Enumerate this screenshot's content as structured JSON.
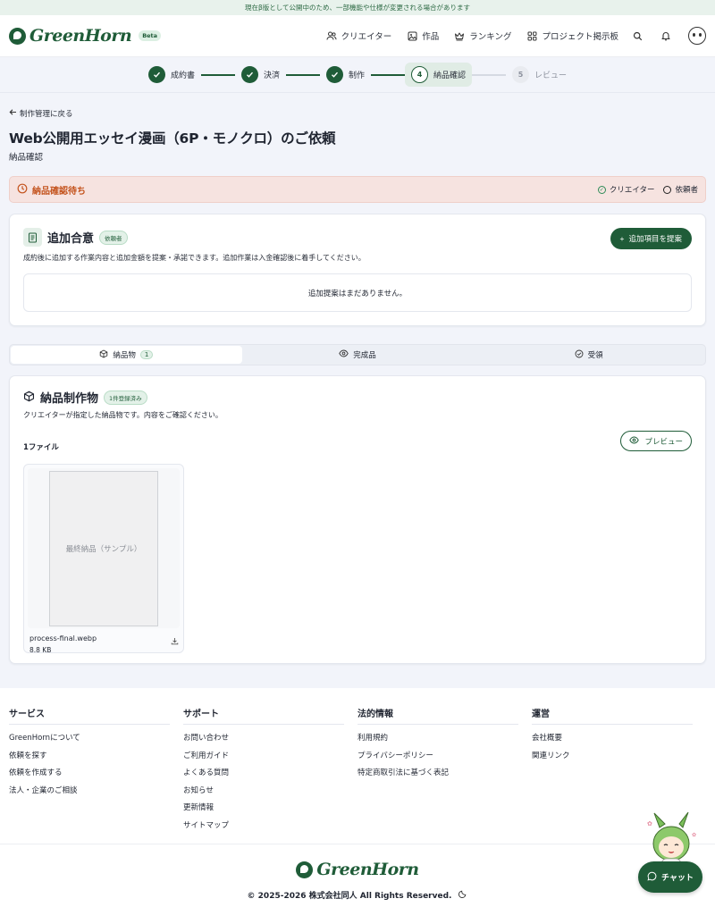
{
  "banner": {
    "text": "現在β版として公開中のため、一部機能や仕様が変更される場合があります"
  },
  "header": {
    "logo_text": "GreenHorn",
    "beta_label": "Beta",
    "nav": [
      {
        "label": "クリエイター",
        "icon": "users-icon"
      },
      {
        "label": "作品",
        "icon": "image-icon"
      },
      {
        "label": "ランキング",
        "icon": "crown-icon"
      },
      {
        "label": "プロジェクト掲示板",
        "icon": "grid-icon"
      }
    ]
  },
  "steps": [
    {
      "label": "成約書",
      "state": "done"
    },
    {
      "label": "決済",
      "state": "done"
    },
    {
      "label": "制作",
      "state": "done"
    },
    {
      "label": "納品確認",
      "number": "4",
      "state": "current"
    },
    {
      "label": "レビュー",
      "number": "5",
      "state": "pending"
    }
  ],
  "page": {
    "back_label": "制作管理に戻る",
    "title": "Web公開用エッセイ漫画（6P・モノクロ）のご依頼",
    "subtitle": "納品確認"
  },
  "status": {
    "label": "納品確認待ち",
    "creator_label": "クリエイター",
    "client_label": "依頼者"
  },
  "addon": {
    "title": "追加合意",
    "badge": "依頼者",
    "description": "成約後に追加する作業内容と追加金額を提案・承諾できます。追加作業は入金確認後に着手してください。",
    "button": "追加項目を提案",
    "empty": "追加提案はまだありません。"
  },
  "tabs": [
    {
      "label": "納品物",
      "count": "1"
    },
    {
      "label": "完成品"
    },
    {
      "label": "受領"
    }
  ],
  "deliverables": {
    "title": "納品制作物",
    "badge": "1件登録済み",
    "description": "クリエイターが指定した納品物です。内容をご確認ください。",
    "file_count": "1ファイル",
    "preview_button": "プレビュー",
    "file": {
      "thumb_label": "最終納品（サンプル）",
      "name": "process-final.webp",
      "size": "8.8 KB"
    }
  },
  "footer": {
    "columns": [
      {
        "title": "サービス",
        "links": [
          "GreenHornについて",
          "依頼を探す",
          "依頼を作成する",
          "法人・企業のご相談"
        ]
      },
      {
        "title": "サポート",
        "links": [
          "お問い合わせ",
          "ご利用ガイド",
          "よくある質問",
          "お知らせ",
          "更新情報",
          "サイトマップ"
        ]
      },
      {
        "title": "法的情報",
        "links": [
          "利用規約",
          "プライバシーポリシー",
          "特定商取引法に基づく表記"
        ]
      },
      {
        "title": "運営",
        "links": [
          "会社概要",
          "関連リンク"
        ]
      }
    ],
    "logo_text": "GreenHorn",
    "copyright": "© 2025-2026 株式会社同人 All Rights Reserved."
  },
  "chat": {
    "label": "チャット"
  },
  "colors": {
    "brand": "#1f5c38",
    "warning": "#c4541e",
    "page_bg": "#f2f4fa"
  }
}
